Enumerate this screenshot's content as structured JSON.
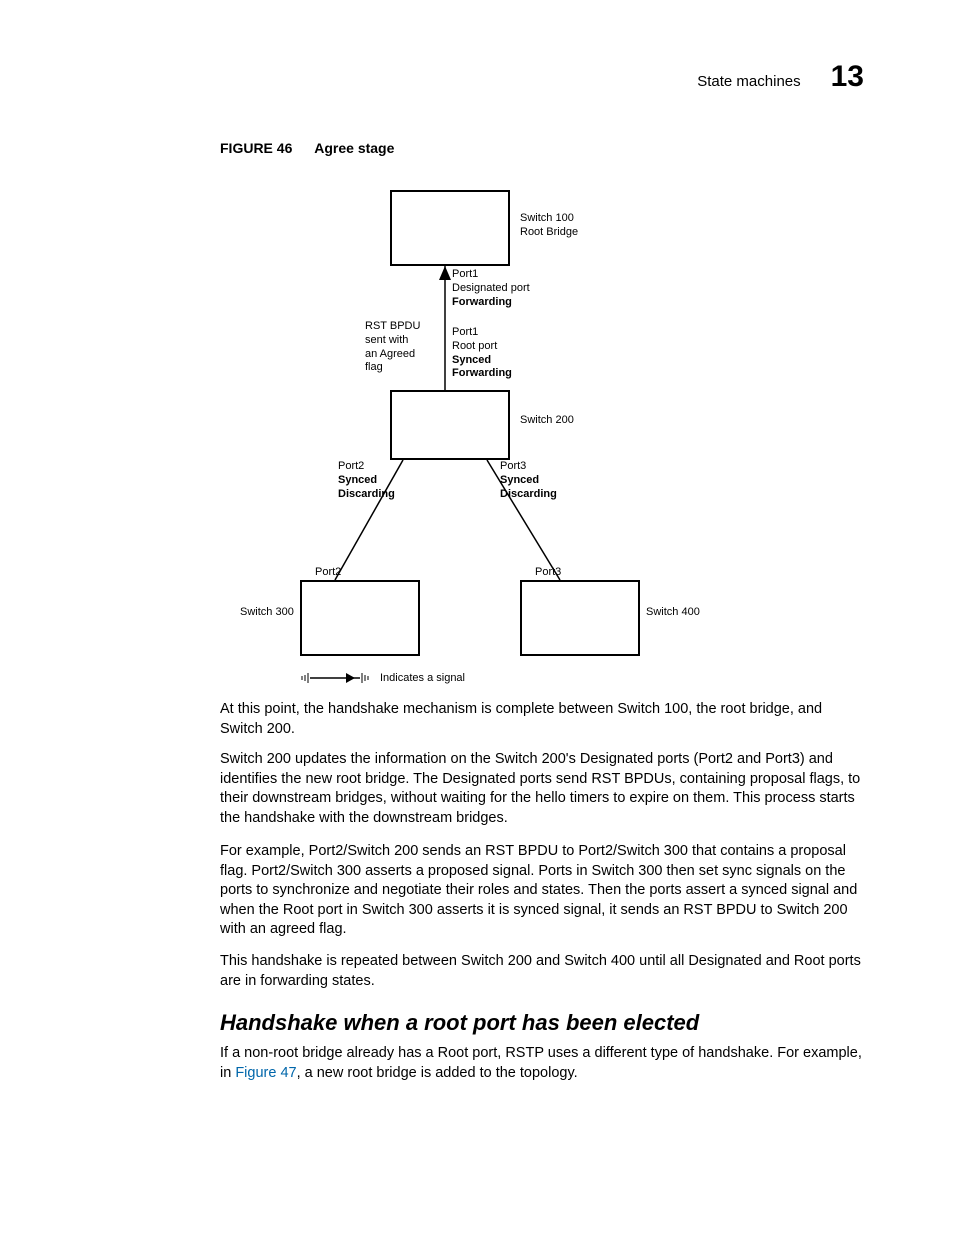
{
  "header": {
    "title": "State machines",
    "chapter": "13"
  },
  "figure": {
    "label": "FIGURE 46",
    "title": "Agree stage"
  },
  "diagram": {
    "switch100": {
      "label1": "Switch 100",
      "label2": "Root Bridge"
    },
    "port1_top": {
      "l1": "Port1",
      "l2": "Designated port",
      "l3": "Forwarding"
    },
    "bpdu": {
      "l1": "RST BPDU",
      "l2": "sent with",
      "l3": "an Agreed",
      "l4": "flag"
    },
    "port1_bot": {
      "l1": "Port1",
      "l2": "Root port",
      "l3": "Synced",
      "l4": "Forwarding"
    },
    "switch200": "Switch 200",
    "port2_top": {
      "l1": "Port2",
      "l2": "Synced",
      "l3": "Discarding"
    },
    "port3_top": {
      "l1": "Port3",
      "l2": "Synced",
      "l3": "Discarding"
    },
    "port2_bot": "Port2",
    "port3_bot": "Port3",
    "switch300": "Switch 300",
    "switch400": "Switch 400",
    "legend": "Indicates a signal"
  },
  "paragraphs": {
    "p1": "At this point, the handshake mechanism is complete between Switch 100, the root bridge, and Switch 200.",
    "p2": "Switch 200 updates the information on the Switch 200's Designated ports (Port2 and Port3) and identifies the new root bridge. The Designated ports send RST BPDUs, containing proposal flags, to their downstream bridges, without waiting for the hello timers to expire on them. This process starts the handshake with the downstream bridges.",
    "p3": "For example, Port2/Switch 200 sends an RST BPDU to Port2/Switch 300 that contains a proposal flag. Port2/Switch 300 asserts a proposed signal. Ports in Switch 300 then set sync signals on the ports to synchronize and negotiate their roles and states. Then the ports assert a synced signal and when the Root port in Switch 300 asserts it is synced signal, it sends an RST BPDU to Switch 200 with an agreed flag.",
    "p4": "This handshake is repeated between Switch 200 and Switch 400 until all Designated and Root ports are in forwarding states.",
    "h2": "Handshake when a root port has been elected",
    "p5a": "If a non-root bridge already has a Root port, RSTP uses a different type of handshake. For example, in ",
    "p5link": "Figure 47",
    "p5b": ", a new root bridge is added to the topology."
  }
}
